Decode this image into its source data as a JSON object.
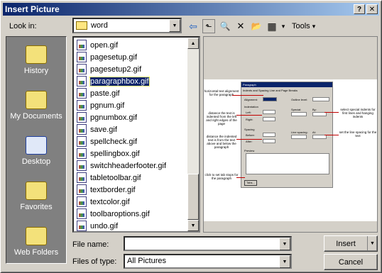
{
  "dialog": {
    "title": "Insert Picture",
    "help_glyph": "?",
    "close_glyph": "✕"
  },
  "lookin": {
    "label": "Look in:",
    "value": "word",
    "arrow": "▼"
  },
  "toolbar": {
    "back_glyph": "⇦",
    "up_glyph": "⬑",
    "search_web_glyph": "🔍",
    "delete_glyph": "✕",
    "new_folder_glyph": "📂",
    "views_glyph": "▦",
    "views_arrow": "▾",
    "tools_label": "Tools",
    "tools_arrow": "▾"
  },
  "places": [
    {
      "label": "History",
      "icon": "history-folder-icon",
      "color": "#f3e17a"
    },
    {
      "label": "My Documents",
      "icon": "my-documents-folder-icon",
      "color": "#f3e17a"
    },
    {
      "label": "Desktop",
      "icon": "desktop-icon",
      "color": "#e0e8f8"
    },
    {
      "label": "Favorites",
      "icon": "favorites-folder-icon",
      "color": "#f3e17a"
    },
    {
      "label": "Web Folders",
      "icon": "web-folders-icon",
      "color": "#f3e17a"
    }
  ],
  "files": [
    "open.gif",
    "pagesetup.gif",
    "pagesetup2.gif",
    "paragraphbox.gif",
    "paste.gif",
    "pgnum.gif",
    "pgnumbox.gif",
    "save.gif",
    "spellcheck.gif",
    "spellingbox.gif",
    "switchheaderfooter.gif",
    "tabletoolbar.gif",
    "textborder.gif",
    "textcolor.gif",
    "toolbaroptions.gif",
    "undo.gif"
  ],
  "selected_file": "paragraphbox.gif",
  "scrollbar": {
    "up": "▲",
    "down": "▼"
  },
  "preview": {
    "dialog_title": "Paragraph",
    "tabs": "Indents and Spacing   Line and Page Breaks",
    "annotations": [
      "horizontal text alignment for the paragraph",
      "distance the text is indented from the left and right edges of the page",
      "distance the indented text is from the text above and below the paragraph",
      "click to set tab stops for the paragraph",
      "select special indents for first lines and hanging indents",
      "set the line spacing for the text"
    ],
    "field_labels": {
      "alignment": "Alignment:",
      "outline": "Outline level:",
      "indentation": "Indentation",
      "left": "Left:",
      "right": "Right:",
      "special": "Special:",
      "by": "By:",
      "spacing": "Spacing",
      "before": "Before:",
      "after": "After:",
      "line_spacing": "Line spacing:",
      "at": "At:",
      "preview": "Preview",
      "tabs_button": "Tabs..."
    }
  },
  "file_name": {
    "label": "File name:",
    "value": "",
    "arrow": "▼"
  },
  "file_type": {
    "label": "Files of type:",
    "value": "All Pictures",
    "arrow": "▼"
  },
  "buttons": {
    "insert": "Insert",
    "insert_arrow": "▼",
    "cancel": "Cancel"
  }
}
